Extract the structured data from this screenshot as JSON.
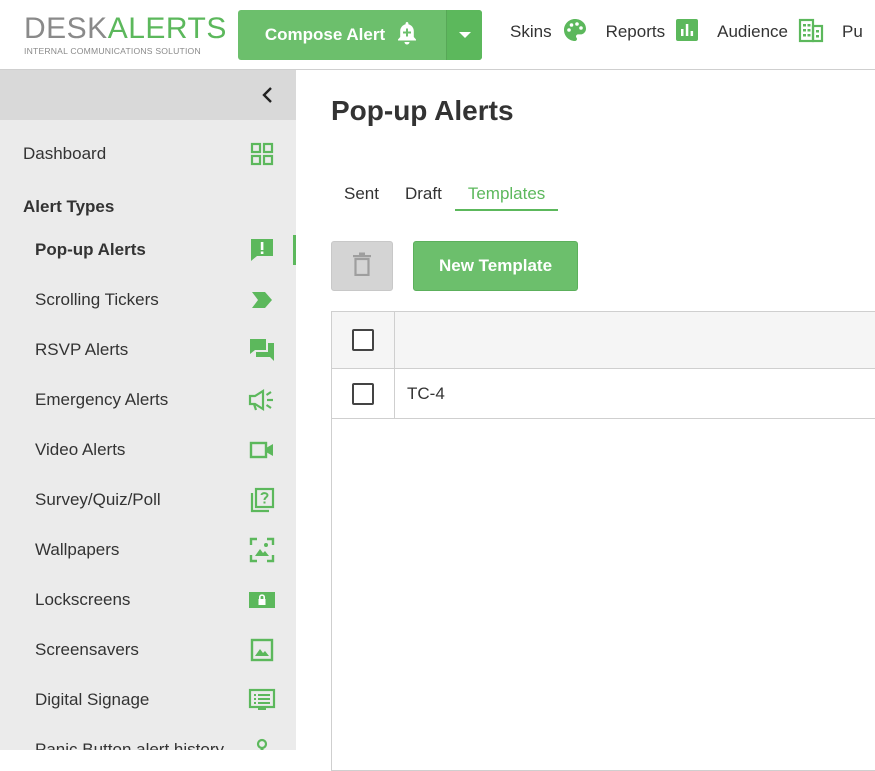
{
  "colors": {
    "accent": "#5cb85c",
    "accent_button": "#6cbf6c",
    "sidebar_bg": "#ebebeb"
  },
  "header": {
    "logo": {
      "word1": "DESK",
      "word2": "ALERTS",
      "tagline": "INTERNAL COMMUNICATIONS SOLUTION"
    },
    "compose": {
      "label": "Compose Alert",
      "icon": "bell-plus-icon",
      "dropdown_icon": "caret-down-icon"
    },
    "nav": [
      {
        "label": "Skins",
        "icon": "palette-icon"
      },
      {
        "label": "Reports",
        "icon": "bar-chart-icon"
      },
      {
        "label": "Audience",
        "icon": "building-icon"
      },
      {
        "label": "Pu",
        "icon": ""
      }
    ]
  },
  "sidebar": {
    "collapse_icon": "chevron-left-icon",
    "dashboard": {
      "label": "Dashboard",
      "icon": "grid-icon"
    },
    "section_heading": "Alert Types",
    "items": [
      {
        "label": "Pop-up Alerts",
        "icon": "popup-alert-icon",
        "active": true
      },
      {
        "label": "Scrolling Tickers",
        "icon": "ticker-arrow-icon"
      },
      {
        "label": "RSVP Alerts",
        "icon": "chat-bubbles-icon"
      },
      {
        "label": "Emergency Alerts",
        "icon": "megaphone-icon"
      },
      {
        "label": "Video Alerts",
        "icon": "video-camera-icon"
      },
      {
        "label": "Survey/Quiz/Poll",
        "icon": "question-stack-icon"
      },
      {
        "label": "Wallpapers",
        "icon": "wallpaper-icon"
      },
      {
        "label": "Lockscreens",
        "icon": "lockscreen-icon"
      },
      {
        "label": "Screensavers",
        "icon": "image-icon"
      },
      {
        "label": "Digital Signage",
        "icon": "signage-icon"
      },
      {
        "label": "Panic Button alert history",
        "icon": "panic-button-icon"
      }
    ]
  },
  "main": {
    "title": "Pop-up Alerts",
    "tabs": [
      {
        "label": "Sent",
        "active": false
      },
      {
        "label": "Draft",
        "active": false
      },
      {
        "label": "Templates",
        "active": true
      }
    ],
    "toolbar": {
      "delete_icon": "trash-icon",
      "new_template_label": "New Template"
    },
    "table": {
      "header": {
        "name": ""
      },
      "rows": [
        {
          "name": "TC-4"
        }
      ]
    }
  }
}
